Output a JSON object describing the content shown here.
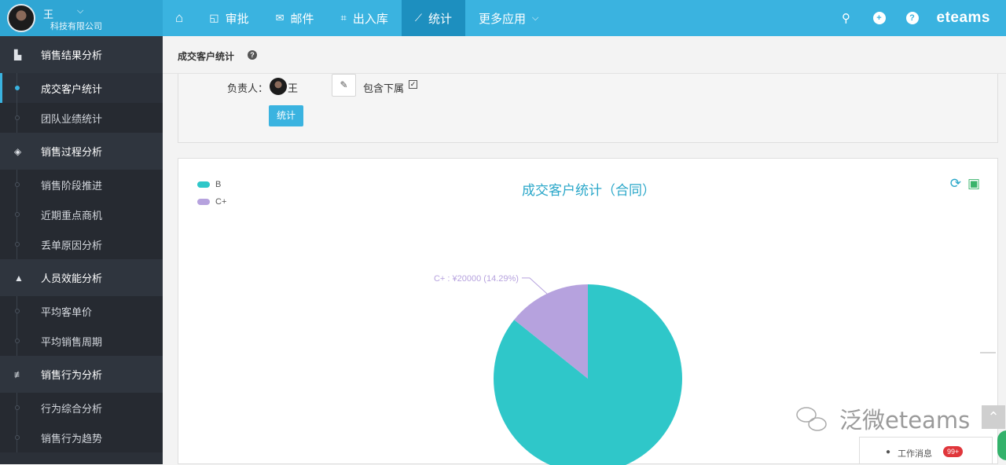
{
  "header": {
    "user_name": "王",
    "company": "科技有限公司",
    "nav": [
      {
        "icon": "home-icon",
        "label": ""
      },
      {
        "icon": "approval-icon",
        "label": "审批"
      },
      {
        "icon": "mail-icon",
        "label": "邮件"
      },
      {
        "icon": "inventory-icon",
        "label": "出入库"
      },
      {
        "icon": "chart-icon",
        "label": "统计"
      },
      {
        "icon": "",
        "label": "更多应用"
      }
    ],
    "logo": "eteams"
  },
  "sidebar": {
    "sections": [
      {
        "label": "销售结果分析",
        "icon": "result-icon",
        "items": [
          "成交客户统计",
          "团队业绩统计"
        ]
      },
      {
        "label": "销售过程分析",
        "icon": "process-icon",
        "items": [
          "销售阶段推进",
          "近期重点商机",
          "丢单原因分析"
        ]
      },
      {
        "label": "人员效能分析",
        "icon": "person-icon",
        "items": [
          "平均客单价",
          "平均销售周期"
        ]
      },
      {
        "label": "销售行为分析",
        "icon": "behavior-icon",
        "items": [
          "行为综合分析",
          "销售行为趋势"
        ]
      }
    ]
  },
  "breadcrumb": {
    "title": "成交客户统计"
  },
  "filter": {
    "owner_label": "负责人：",
    "owner_name": "王",
    "include_sub_label": "包含下属",
    "include_sub_checked": true,
    "stat_button": "统计"
  },
  "chart_data": {
    "type": "pie",
    "title": "成交客户统计（合同）",
    "legend": [
      "B",
      "C+"
    ],
    "legend_position": "top-left",
    "slices": [
      {
        "name": "B",
        "value": 120000,
        "percent": 85.71,
        "color": "#2fc7c9"
      },
      {
        "name": "C+",
        "value": 20000,
        "percent": 14.29,
        "color": "#b6a2de"
      }
    ],
    "labels": [
      {
        "text": "C+ : ¥20000 (14.29%)"
      }
    ]
  },
  "watermark": {
    "text": "泛微eteams"
  },
  "message": {
    "label": "工作消息",
    "badge": "99+"
  }
}
